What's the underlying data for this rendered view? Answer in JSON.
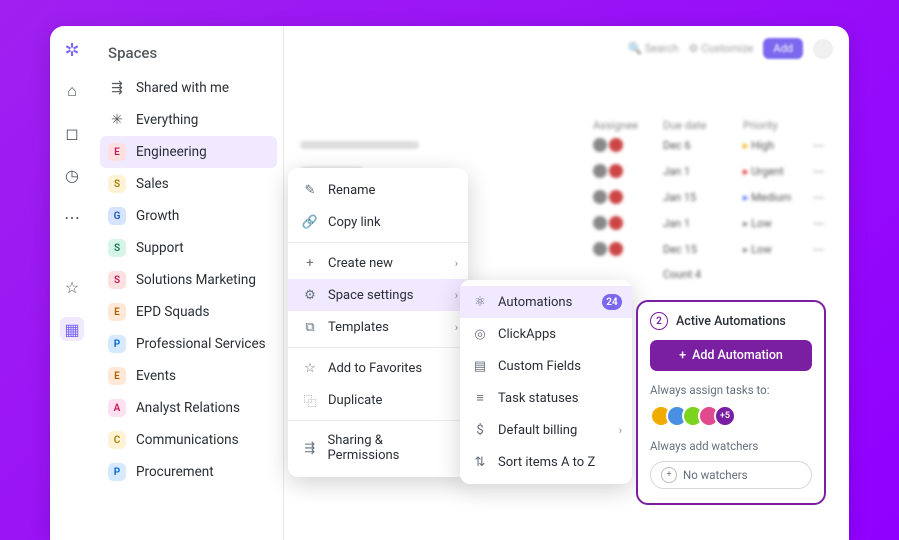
{
  "sidebar": {
    "title": "Spaces",
    "nav": [
      {
        "icon": "share",
        "label": "Shared with me"
      },
      {
        "icon": "everything",
        "label": "Everything"
      }
    ],
    "spaces": [
      {
        "badge": "E",
        "bg": "#ffe0e0",
        "fg": "#c2185b",
        "label": "Engineering",
        "selected": true
      },
      {
        "badge": "S",
        "bg": "#fff3d6",
        "fg": "#a67c00",
        "label": "Sales"
      },
      {
        "badge": "G",
        "bg": "#d6e4ff",
        "fg": "#1e5bb8",
        "label": "Growth"
      },
      {
        "badge": "S",
        "bg": "#d6f5e8",
        "fg": "#0f7a4f",
        "label": "Support"
      },
      {
        "badge": "S",
        "bg": "#ffe0e0",
        "fg": "#c2185b",
        "label": "Solutions Marketing"
      },
      {
        "badge": "E",
        "bg": "#ffe9d6",
        "fg": "#b85c00",
        "label": "EPD Squads"
      },
      {
        "badge": "P",
        "bg": "#d6eaff",
        "fg": "#0066cc",
        "label": "Professional Services"
      },
      {
        "badge": "E",
        "bg": "#ffe9d6",
        "fg": "#b85c00",
        "label": "Events"
      },
      {
        "badge": "A",
        "bg": "#ffe0f0",
        "fg": "#c2185b",
        "label": "Analyst Relations"
      },
      {
        "badge": "C",
        "bg": "#fff3d6",
        "fg": "#a67c00",
        "label": "Communications"
      },
      {
        "badge": "P",
        "bg": "#d6eaff",
        "fg": "#0066cc",
        "label": "Procurement"
      }
    ]
  },
  "topbar": {
    "search": "Search",
    "customize": "Customize",
    "add": "Add"
  },
  "table": {
    "headers": {
      "assignee": "Assignee",
      "due": "Due date",
      "priority": "Priority"
    },
    "rows": [
      {
        "due": "Dec 6",
        "priority": "High",
        "pcolor": "#f0ad00"
      },
      {
        "due": "Jan 1",
        "priority": "Urgent",
        "pcolor": "#e02020"
      },
      {
        "due": "Jan 15",
        "priority": "Medium",
        "pcolor": "#4a6cf7"
      },
      {
        "due": "Jan 1",
        "priority": "Low",
        "pcolor": "#888"
      },
      {
        "due": "Dec 15",
        "priority": "Low",
        "pcolor": "#888"
      }
    ],
    "count_label": "Count 4"
  },
  "menu1": [
    {
      "icon": "pencil",
      "label": "Rename"
    },
    {
      "icon": "link",
      "label": "Copy link"
    },
    {
      "sep": true
    },
    {
      "icon": "plus",
      "label": "Create new",
      "sub": true
    },
    {
      "icon": "gear",
      "label": "Space settings",
      "sub": true,
      "highlighted": true
    },
    {
      "icon": "templates",
      "label": "Templates",
      "sub": true
    },
    {
      "sep": true
    },
    {
      "icon": "star",
      "label": "Add to Favorites"
    },
    {
      "icon": "duplicate",
      "label": "Duplicate"
    },
    {
      "sep": true
    },
    {
      "icon": "sharing",
      "label": "Sharing & Permissions"
    }
  ],
  "menu2": [
    {
      "icon": "automations",
      "label": "Automations",
      "badge": "24",
      "highlighted": true
    },
    {
      "icon": "clickapps",
      "label": "ClickApps"
    },
    {
      "icon": "fields",
      "label": "Custom Fields"
    },
    {
      "icon": "statuses",
      "label": "Task statuses"
    },
    {
      "icon": "billing",
      "label": "Default billing",
      "sub": true
    },
    {
      "icon": "sort",
      "label": "Sort items A to Z"
    }
  ],
  "panel": {
    "count": "2",
    "title": "Active Automations",
    "add_label": "Add Automation",
    "assign_label": "Always assign tasks to:",
    "assignee_more": "+5",
    "watchers_label": "Always add watchers",
    "no_watchers": "No watchers"
  }
}
